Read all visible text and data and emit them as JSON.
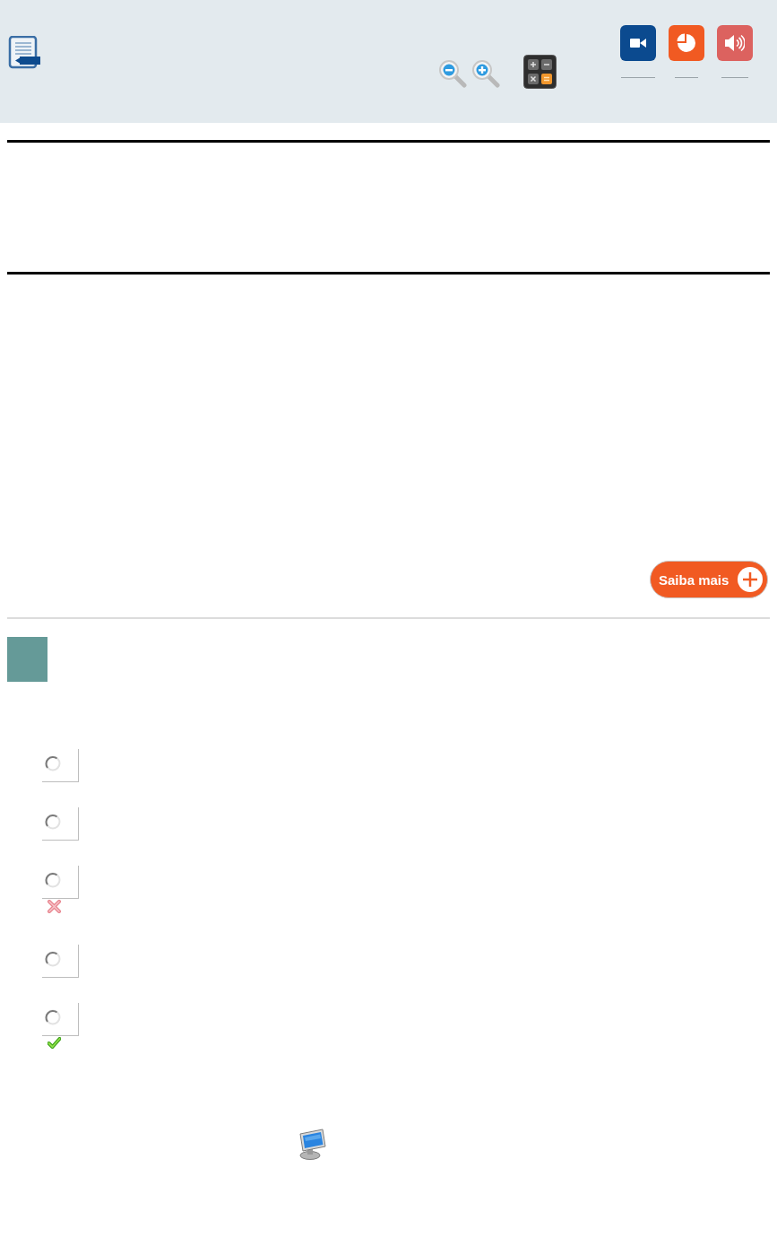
{
  "more_button": {
    "label": "Saiba mais"
  },
  "options": [
    {
      "selected": false,
      "kind": "plain"
    },
    {
      "selected": false,
      "kind": "plain"
    },
    {
      "selected": false,
      "kind": "wrong"
    },
    {
      "selected": false,
      "kind": "plain"
    },
    {
      "selected": false,
      "kind": "correct"
    }
  ]
}
